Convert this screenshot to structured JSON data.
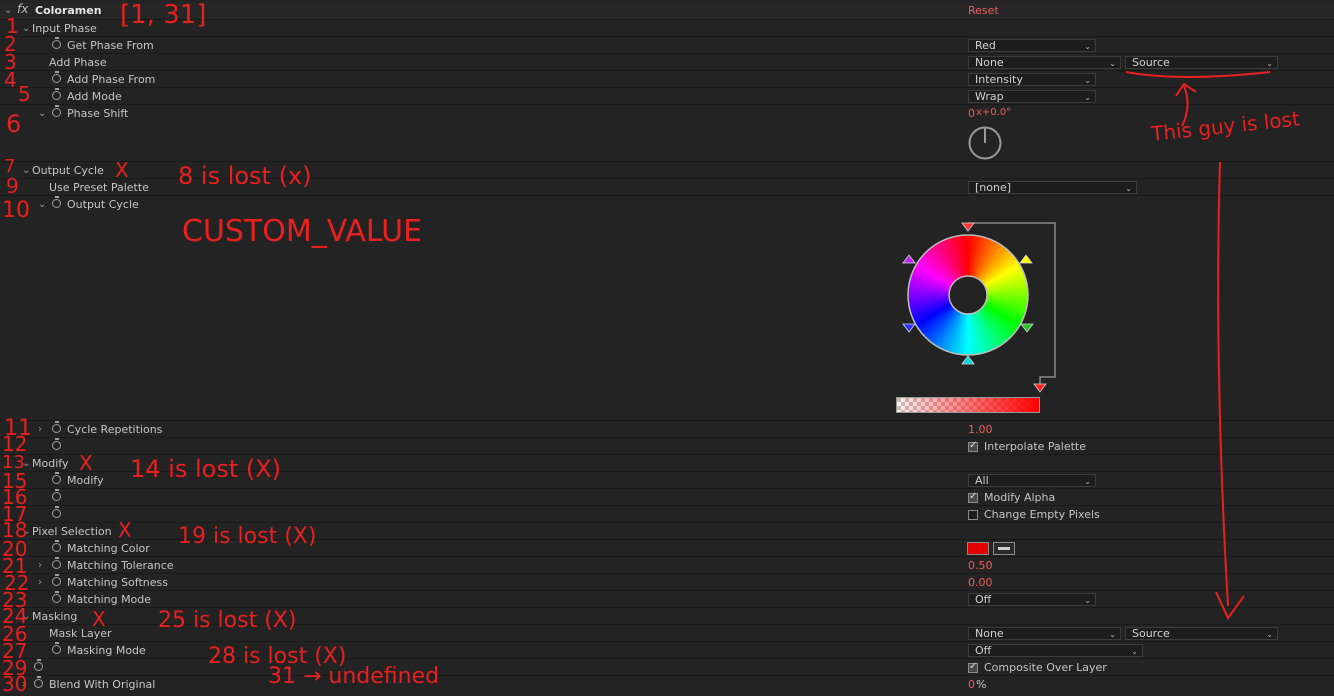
{
  "effect": {
    "name": "Coloramen",
    "reset": "Reset"
  },
  "rows": {
    "input_phase": "Input Phase",
    "get_phase_from": "Get Phase From",
    "get_phase_from_value": "Red",
    "add_phase": "Add Phase",
    "add_phase_value": "None",
    "add_phase_source": "Source",
    "add_phase_from": "Add Phase From",
    "add_phase_from_value": "Intensity",
    "add_mode": "Add Mode",
    "add_mode_value": "Wrap",
    "phase_shift": "Phase Shift",
    "phase_shift_rev": "0",
    "phase_shift_deg": "x+0.0°",
    "output_cycle": "Output Cycle",
    "use_preset_palette": "Use Preset Palette",
    "use_preset_palette_value": "[none]",
    "output_cycle_sub": "Output Cycle",
    "cycle_repetitions": "Cycle Repetitions",
    "cycle_repetitions_value": "1.00",
    "interpolate_palette": "Interpolate Palette",
    "modify": "Modify",
    "modify_param": "Modify",
    "modify_value": "All",
    "modify_alpha": "Modify Alpha",
    "change_empty_pixels": "Change Empty Pixels",
    "pixel_selection": "Pixel Selection",
    "matching_color": "Matching Color",
    "matching_tolerance": "Matching Tolerance",
    "matching_tolerance_value": "0.50",
    "matching_softness": "Matching Softness",
    "matching_softness_value": "0.00",
    "matching_mode": "Matching Mode",
    "matching_mode_value": "Off",
    "masking": "Masking",
    "mask_layer": "Mask Layer",
    "mask_layer_value": "None",
    "mask_layer_source": "Source",
    "masking_mode": "Masking Mode",
    "masking_mode_value": "Off",
    "composite_over_layer": "Composite Over Layer",
    "blend_with_original": "Blend With Original",
    "blend_value": "0",
    "blend_unit": "%"
  },
  "annotations": {
    "range": "[1, 31]",
    "n1": "1",
    "n2": "2",
    "n3": "3",
    "n4": "4",
    "n5": "5",
    "n6": "6",
    "n7": "7",
    "n9": "9",
    "n10": "10",
    "n11": "11",
    "n12": "12",
    "n13": "13",
    "n15": "15",
    "n16": "16",
    "n17": "17",
    "n18": "18",
    "n20": "20",
    "n21": "21",
    "n22": "22",
    "n23": "23",
    "n24": "24",
    "n26": "26",
    "n27": "27",
    "n29": "29",
    "n30": "30",
    "x_mark": "X",
    "lost8": "8 is lost (x)",
    "custom": "CUSTOM_VALUE",
    "lost14": "14 is lost (X)",
    "lost19": "19 is lost (X)",
    "lost25": "25 is lost (X)",
    "lost28": "28 is lost (X)",
    "undefined31": "31 → undefined",
    "guy_lost": "This guy is lost"
  },
  "colors": {
    "panel_bg": "#232323",
    "value_red": "#ef5d5d",
    "matching_color_swatch": "#e30000",
    "annotation_red": "#e8201f"
  },
  "icons": {
    "fx": "fx-icon",
    "stopwatch": "stopwatch-icon",
    "twirl": "chevron-icon",
    "eyedropper": "eyedropper-icon"
  }
}
